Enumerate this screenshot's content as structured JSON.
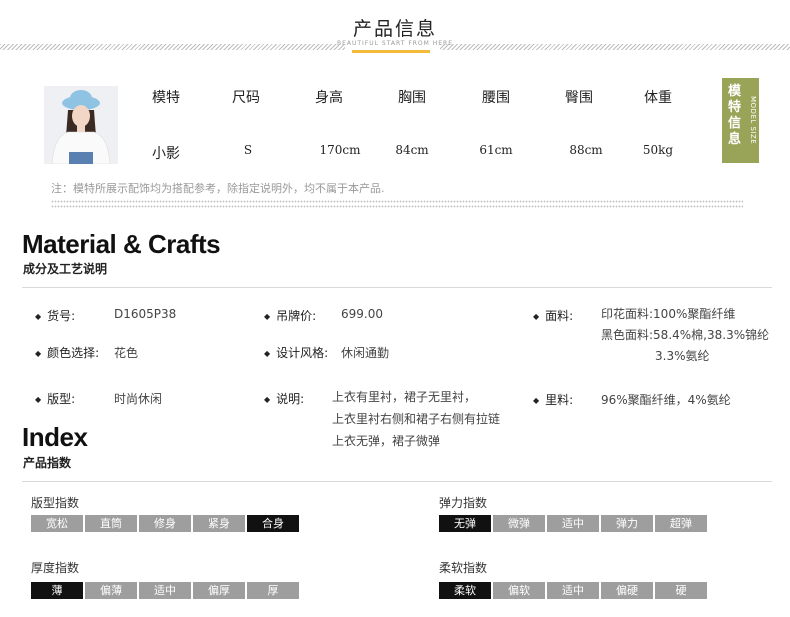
{
  "header": {
    "title": "产品信息",
    "subtitle": "BEAUTIFUL START FROM HERE"
  },
  "model": {
    "columns": [
      {
        "label": "模特",
        "value": "小影"
      },
      {
        "label": "尺码",
        "value": "S"
      },
      {
        "label": "身高",
        "value": "170cm"
      },
      {
        "label": "胸围",
        "value": "84cm"
      },
      {
        "label": "腰围",
        "value": "61cm"
      },
      {
        "label": "臀围",
        "value": "88cm"
      },
      {
        "label": "体重",
        "value": "50kg"
      }
    ],
    "side_tag": {
      "cn": "模特信息",
      "en": "MODEL SIZE"
    },
    "note": "注：模特所展示配饰均为搭配参考，除指定说明外，均不属于本产品."
  },
  "material": {
    "title": "Material & Crafts",
    "subtitle": "成分及工艺说明",
    "item_no": {
      "key": "货号:",
      "value": "D1605P38"
    },
    "tag_price": {
      "key": "吊牌价:",
      "value": "699.00"
    },
    "fabric": {
      "key": "面料:",
      "lines": [
        "印花面料:100%聚酯纤维",
        "黑色面料:58.4%棉,38.3%锦纶",
        "3.3%氨纶"
      ]
    },
    "color": {
      "key": "颜色选择:",
      "value": "花色"
    },
    "style": {
      "key": "设计风格:",
      "value": "休闲通勤"
    },
    "fit": {
      "key": "版型:",
      "value": "时尚休闲"
    },
    "description": {
      "key": "说明:",
      "lines": [
        "上衣有里衬，裙子无里衬，",
        "上衣里衬右侧和裙子右侧有拉链",
        "上衣无弹，裙子微弹"
      ]
    },
    "lining": {
      "key": "里料:",
      "value": "96%聚酯纤维，4%氨纶"
    }
  },
  "index": {
    "title": "Index",
    "subtitle": "产品指数",
    "scales": [
      {
        "label": "版型指数",
        "options": [
          "宽松",
          "直筒",
          "修身",
          "紧身",
          "合身"
        ],
        "selected": 4
      },
      {
        "label": "弹力指数",
        "options": [
          "无弹",
          "微弹",
          "适中",
          "弹力",
          "超弹"
        ],
        "selected": 0
      },
      {
        "label": "厚度指数",
        "options": [
          "薄",
          "偏薄",
          "适中",
          "偏厚",
          "厚"
        ],
        "selected": 0
      },
      {
        "label": "柔软指数",
        "options": [
          "柔软",
          "偏软",
          "适中",
          "偏硬",
          "硬"
        ],
        "selected": 0
      }
    ]
  }
}
